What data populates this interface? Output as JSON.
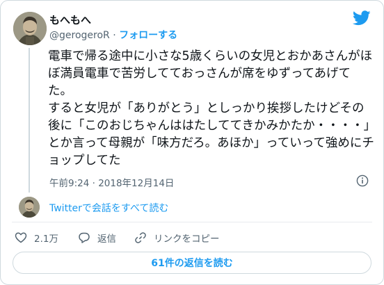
{
  "user": {
    "display_name": "もへもへ",
    "handle": "@gerogeroR",
    "separator": "·",
    "follow_label": "フォローする"
  },
  "tweet": {
    "text": "電車で帰る途中に小さな5歳くらいの女児とおかあさんがほぼ満員電車で苦労してておっさんが席をゆずってあげてた。\nすると女児が「ありがとう」としっかり挨拶したけどその後に「このおじちゃんははたしててきかみかたか・・・・」とか言って母親が「味方だろ。あほか」っていって強めにチョップしてた",
    "timestamp": "午前9:24 · 2018年12月14日"
  },
  "conversation": {
    "link_label": "Twitterで会話をすべて読む"
  },
  "actions": {
    "like_count": "2.1万",
    "reply_label": "返信",
    "copy_link_label": "リンクをコピー"
  },
  "footer": {
    "read_replies_label": "61件の返信を読む"
  },
  "colors": {
    "accent": "#1d9bf0",
    "muted_text": "#536471",
    "border": "#cfd9de",
    "text": "#0f1419"
  },
  "icons": [
    "twitter-bird-icon",
    "info-icon",
    "heart-icon",
    "reply-bubble-icon",
    "link-icon"
  ]
}
